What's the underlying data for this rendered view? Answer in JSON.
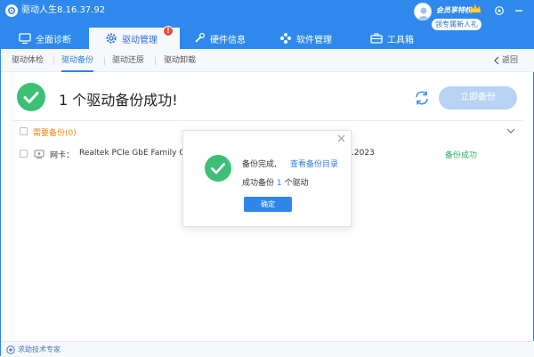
{
  "app": {
    "title": "驱动人生8.16.37.92"
  },
  "header": {
    "vip_label": "会员享特权",
    "newbie_label": "领专属新人礼",
    "tabs": [
      {
        "label": "全面诊断",
        "icon": "monitor-icon"
      },
      {
        "label": "驱动管理",
        "icon": "gear-icon",
        "badge": "!"
      },
      {
        "label": "硬件信息",
        "icon": "wrench-icon"
      },
      {
        "label": "软件管理",
        "icon": "apps-icon"
      },
      {
        "label": "工具箱",
        "icon": "toolbox-icon"
      }
    ]
  },
  "subnav": {
    "tabs": [
      "驱动体检",
      "驱动备份",
      "驱动还原",
      "驱动卸载"
    ],
    "active": "驱动备份",
    "back_label": "返回"
  },
  "main": {
    "title": "1 个驱动备份成功!",
    "backup_button": "立即备份",
    "group_label": "需要备份(0)",
    "rows": [
      {
        "type": "网卡：",
        "name": "Realtek PCIe GbE Family Controller",
        "date_partial": ".2023",
        "status": "备份成功"
      }
    ]
  },
  "dialog": {
    "line1": "备份完成,",
    "link": "查看备份目录",
    "line2_prefix": "成功备份",
    "count": "1",
    "line2_suffix": "个驱动",
    "ok_label": "确定"
  },
  "footer": {
    "help_label": "求助技术专家"
  },
  "colors": {
    "brand": "#2f89ec",
    "success": "#3cc076",
    "warning": "#e88a1a",
    "link": "#2f7fe0"
  }
}
